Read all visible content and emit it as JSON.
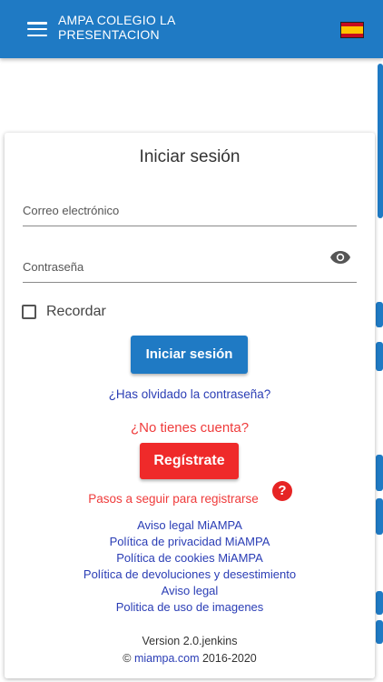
{
  "header": {
    "title": "AMPA COLEGIO LA PRESENTACION",
    "menu_icon": "hamburger-icon",
    "language_flag": "spain-flag-icon",
    "color": "#1f7ac4"
  },
  "login": {
    "title": "Iniciar sesión",
    "email_label": "Correo electrónico",
    "email_value": "",
    "password_label": "Contraseña",
    "password_value": "",
    "show_password_icon": "eye-icon",
    "remember_label": "Recordar",
    "remember_checked": false,
    "submit_label": "Iniciar sesión",
    "forgot_link": "¿Has olvidado la contraseña?"
  },
  "register": {
    "question": "¿No tienes cuenta?",
    "button_label": "Regístrate",
    "steps_link": "Pasos a seguir para registrarse",
    "help_icon": "question-mark-icon",
    "color": "#ef2a2a"
  },
  "legal_links": [
    "Aviso legal MiAMPA",
    "Política de privacidad MiAMPA",
    "Política de cookies MiAMPA",
    "Política de devoluciones y desestimiento",
    "Aviso legal",
    "Politica de uso de imagenes"
  ],
  "footer": {
    "version": "Version 2.0.jenkins",
    "copyright_symbol": "©",
    "site": "miampa.com",
    "years": "2016-2020"
  }
}
